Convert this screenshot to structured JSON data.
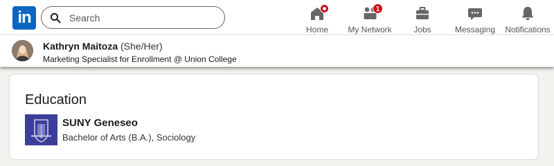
{
  "header": {
    "logo_text": "in",
    "search": {
      "placeholder": "Search",
      "value": ""
    },
    "nav": [
      {
        "label": "Home",
        "icon": "home-icon",
        "badge": ""
      },
      {
        "label": "My Network",
        "icon": "my-network-icon",
        "badge": "1"
      },
      {
        "label": "Jobs",
        "icon": "briefcase-icon",
        "badge": ""
      },
      {
        "label": "Messaging",
        "icon": "messaging-icon",
        "badge": ""
      },
      {
        "label": "Notifications",
        "icon": "bell-icon",
        "badge": ""
      }
    ]
  },
  "profile": {
    "name": "Kathryn Maitoza",
    "pronouns": "(She/Her)",
    "headline": "Marketing Specialist for Enrollment @ Union College"
  },
  "education": {
    "title": "Education",
    "items": [
      {
        "school": "SUNY Geneseo",
        "degree": "Bachelor of Arts (B.A.), Sociology"
      }
    ]
  },
  "colors": {
    "brand": "#0a66c2",
    "badge": "#cc1016",
    "school_logo": "#3c3f97"
  }
}
